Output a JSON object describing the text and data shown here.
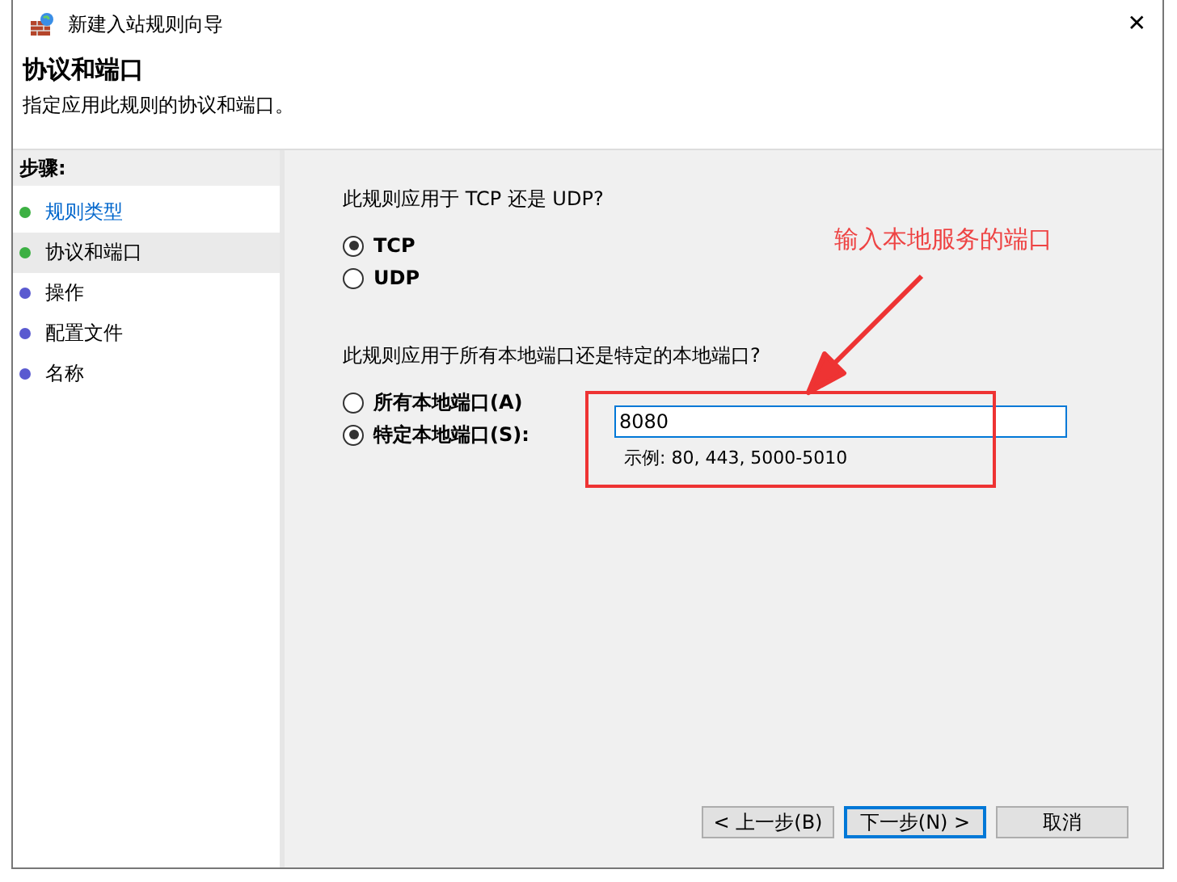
{
  "window": {
    "title": "新建入站规则向导",
    "close": "✕"
  },
  "header": {
    "title": "协议和端口",
    "subtitle": "指定应用此规则的协议和端口。"
  },
  "steps": {
    "title": "步骤:",
    "items": [
      {
        "label": "规则类型",
        "color": "#3cb043",
        "selected": false,
        "link": true
      },
      {
        "label": "协议和端口",
        "color": "#3cb043",
        "selected": true,
        "link": false
      },
      {
        "label": "操作",
        "color": "#5a5ad0",
        "selected": false,
        "link": false
      },
      {
        "label": "配置文件",
        "color": "#5a5ad0",
        "selected": false,
        "link": false
      },
      {
        "label": "名称",
        "color": "#5a5ad0",
        "selected": false,
        "link": false
      }
    ]
  },
  "protocol": {
    "question": "此规则应用于 TCP 还是 UDP?",
    "options": [
      {
        "label": "TCP",
        "selected": true
      },
      {
        "label": "UDP",
        "selected": false
      }
    ]
  },
  "ports": {
    "question": "此规则应用于所有本地端口还是特定的本地端口?",
    "options": [
      {
        "label": "所有本地端口(A)",
        "selected": false
      },
      {
        "label": "特定本地端口(S):",
        "selected": true
      }
    ],
    "field": {
      "value": "8080"
    },
    "hint": "示例: 80, 443, 5000-5010"
  },
  "annotation": {
    "text": "输入本地服务的端口"
  },
  "buttons": [
    {
      "label": "< 上一步(B)",
      "default": false
    },
    {
      "label": "下一步(N) >",
      "default": true
    },
    {
      "label": "取消",
      "default": false
    }
  ]
}
